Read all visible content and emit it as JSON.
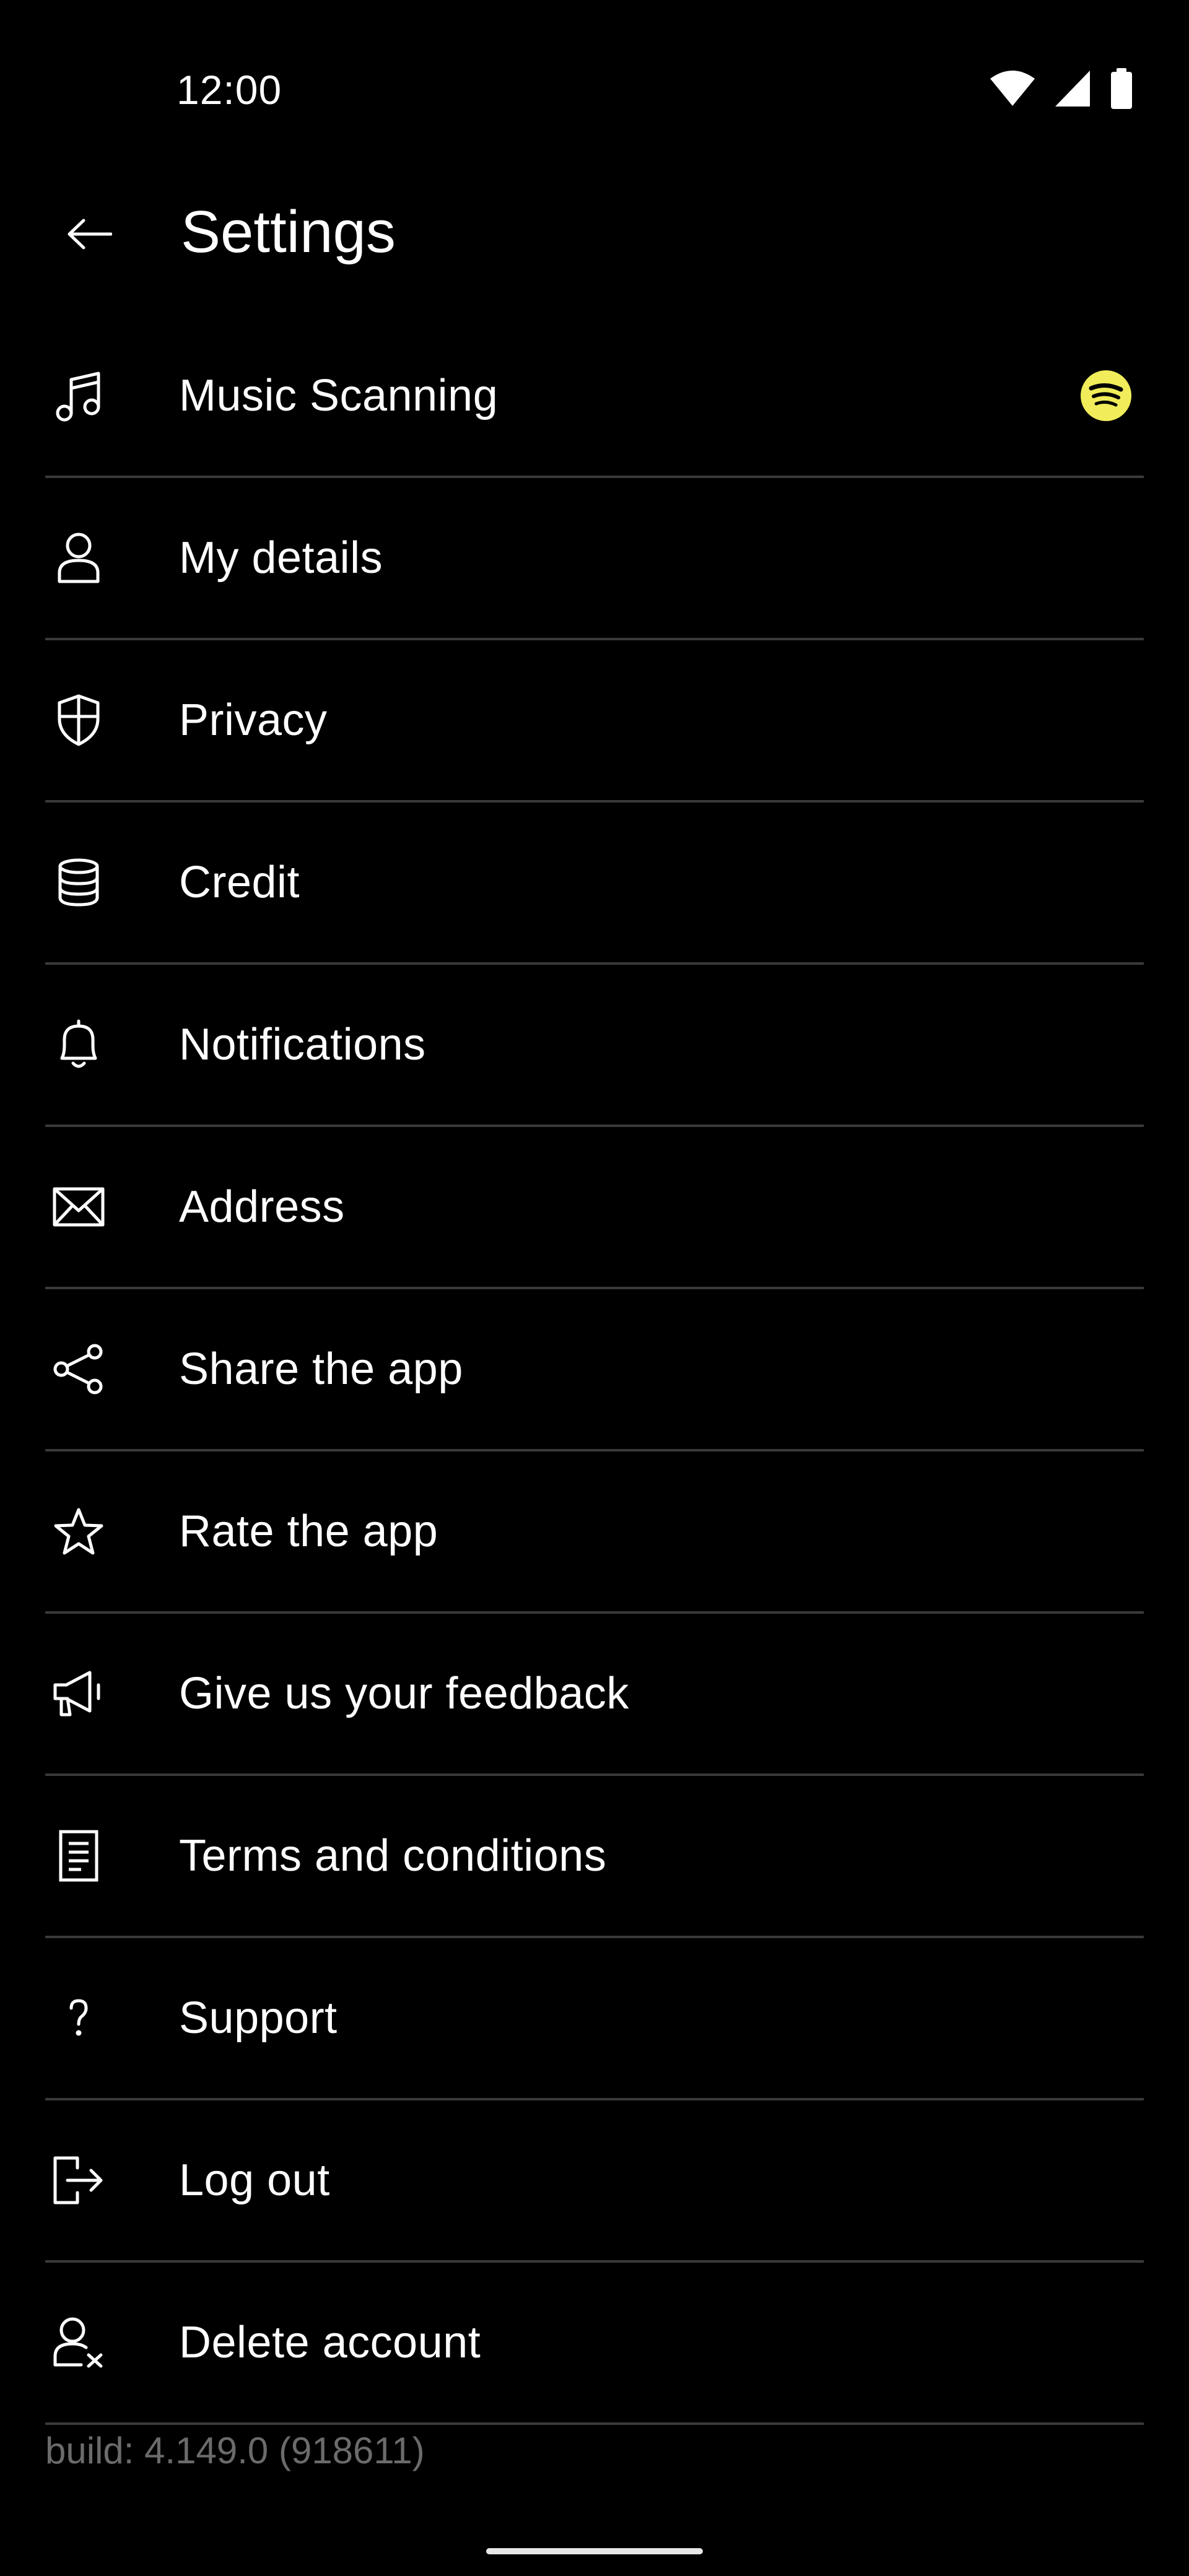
{
  "status_bar": {
    "time": "12:00"
  },
  "header": {
    "title": "Settings"
  },
  "settings_items": [
    {
      "label": "Music Scanning",
      "icon": "music-note-icon",
      "badge": "spotify-icon"
    },
    {
      "label": "My details",
      "icon": "person-icon"
    },
    {
      "label": "Privacy",
      "icon": "shield-icon"
    },
    {
      "label": "Credit",
      "icon": "coin-stack-icon"
    },
    {
      "label": "Notifications",
      "icon": "bell-icon"
    },
    {
      "label": "Address",
      "icon": "envelope-icon"
    },
    {
      "label": "Share the app",
      "icon": "share-icon"
    },
    {
      "label": "Rate the app",
      "icon": "star-icon"
    },
    {
      "label": "Give us your feedback",
      "icon": "megaphone-icon"
    },
    {
      "label": "Terms and conditions",
      "icon": "document-icon"
    },
    {
      "label": "Support",
      "icon": "question-icon"
    },
    {
      "label": "Log out",
      "icon": "logout-icon"
    },
    {
      "label": "Delete account",
      "icon": "delete-user-icon"
    }
  ],
  "footer": {
    "build": "build: 4.149.0 (918611)"
  },
  "colors": {
    "background": "#000000",
    "text": "#ffffff",
    "divider": "#3a3a3a",
    "spotify_badge": "#f0ec5a",
    "muted_text": "#6b6b6b"
  }
}
